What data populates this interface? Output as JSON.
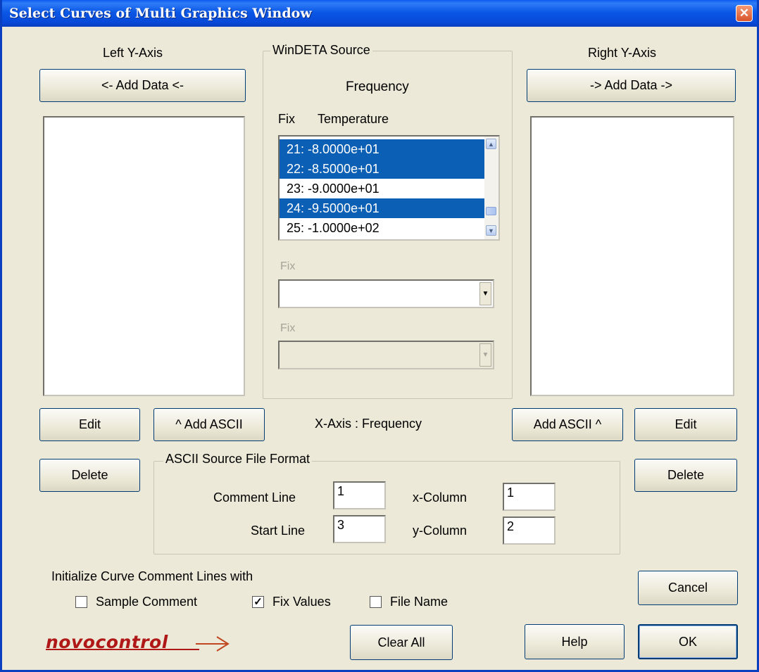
{
  "window": {
    "title": "Select Curves of Multi Graphics Window",
    "close_glyph": "✕"
  },
  "left_axis": {
    "label": "Left Y-Axis",
    "add_data": "<- Add Data <-",
    "edit": "Edit",
    "delete": "Delete"
  },
  "right_axis": {
    "label": "Right Y-Axis",
    "add_data": "-> Add Data ->",
    "edit": "Edit",
    "delete": "Delete"
  },
  "add_ascii_left": "^ Add ASCII",
  "add_ascii_right": "Add ASCII ^",
  "xaxis_label": "X-Axis : Frequency",
  "source": {
    "legend": "WinDETA Source",
    "primary": "Frequency",
    "fix_label": "Fix",
    "fix_param": "Temperature",
    "items": [
      {
        "text": "21: -8.0000e+01",
        "selected": true
      },
      {
        "text": "22: -8.5000e+01",
        "selected": true
      },
      {
        "text": "23: -9.0000e+01",
        "selected": false
      },
      {
        "text": "24: -9.5000e+01",
        "selected": true
      },
      {
        "text": "25: -1.0000e+02",
        "selected": false
      }
    ],
    "fix2_label": "Fix",
    "fix2_value": "",
    "fix3_label": "Fix",
    "fix3_value": ""
  },
  "ascii_format": {
    "legend": "ASCII Source File Format",
    "comment_line_label": "Comment Line",
    "comment_line_value": "1",
    "start_line_label": "Start Line",
    "start_line_value": "3",
    "x_column_label": "x-Column",
    "x_column_value": "1",
    "y_column_label": "y-Column",
    "y_column_value": "2"
  },
  "init": {
    "label": "Initialize Curve Comment Lines with",
    "options": [
      {
        "label": "Sample Comment",
        "checked": false
      },
      {
        "label": "Fix Values",
        "checked": true
      },
      {
        "label": "File Name",
        "checked": false
      }
    ]
  },
  "buttons": {
    "cancel": "Cancel",
    "clear_all": "Clear All",
    "help": "Help",
    "ok": "OK"
  },
  "logo": "novocontrol",
  "colors": {
    "selection": "#0b5fb5",
    "titlebar": "#0a5bf0",
    "logo": "#b01818"
  }
}
